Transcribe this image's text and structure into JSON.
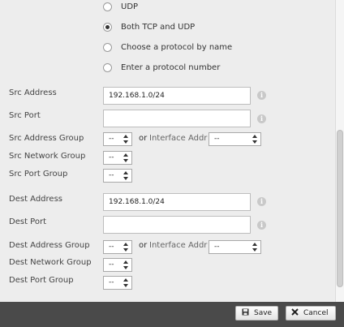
{
  "protocol": {
    "options": [
      {
        "label": "UDP",
        "checked": false
      },
      {
        "label": "Both TCP and UDP",
        "checked": true
      },
      {
        "label": "Choose a protocol by name",
        "checked": false
      },
      {
        "label": "Enter a protocol number",
        "checked": false
      }
    ]
  },
  "src": {
    "address_label": "Src Address",
    "address_value": "192.168.1.0/24",
    "port_label": "Src Port",
    "port_value": "",
    "address_group_label": "Src Address Group",
    "address_group_value": "--",
    "network_group_label": "Src Network Group",
    "network_group_value": "--",
    "port_group_label": "Src Port Group",
    "port_group_value": "--",
    "or_text": "or",
    "iface_label": "Interface Addr",
    "iface_value": "--"
  },
  "dest": {
    "address_label": "Dest Address",
    "address_value": "192.168.1.0/24",
    "port_label": "Dest Port",
    "port_value": "",
    "address_group_label": "Dest Address Group",
    "address_group_value": "--",
    "network_group_label": "Dest Network Group",
    "network_group_value": "--",
    "port_group_label": "Dest Port Group",
    "port_group_value": "--",
    "or_text": "or",
    "iface_label": "Interface Addr",
    "iface_value": "--"
  },
  "icons": {
    "info": "i"
  },
  "footer": {
    "save_label": "Save",
    "cancel_label": "Cancel"
  }
}
